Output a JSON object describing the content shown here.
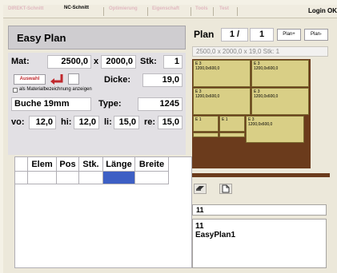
{
  "tabs": [
    {
      "label": "DIREKT-Schnitt",
      "active": false
    },
    {
      "label": "NC-Schnitt",
      "active": true
    },
    {
      "label": "Optimierung",
      "active": false
    },
    {
      "label": "Eigenschaft",
      "active": false
    },
    {
      "label": "Tools",
      "active": false
    },
    {
      "label": "Test",
      "active": false
    }
  ],
  "login_label": "Login OK",
  "title": "Easy Plan",
  "form": {
    "mat_label": "Mat:",
    "mat_width": "2500,0",
    "x_label": "x",
    "mat_height": "2000,0",
    "stk_label": "Stk:",
    "stk_value": "1",
    "auswahl_label": "Auswahl",
    "dicke_label": "Dicke:",
    "dicke_value": "19,0",
    "checkbox_label": "als Materialbezeichnung anzeigen",
    "material_name": "Buche 19mm",
    "type_label": "Type:",
    "type_value": "1245",
    "vo_label": "vo:",
    "vo_value": "12,0",
    "hi_label": "hi:",
    "hi_value": "12,0",
    "li_label": "li:",
    "li_value": "15,0",
    "re_label": "re:",
    "re_value": "15,0"
  },
  "grid_headers": [
    "Elem",
    "Pos",
    "Stk.",
    "Länge",
    "Breite"
  ],
  "plan": {
    "label": "Plan",
    "current": "1 /",
    "total": "1",
    "plus_label": "Plan+",
    "minus_label": "Plan-",
    "info": "2500,0 x 2000,0 x 19,0 Stk: 1"
  },
  "boards": [
    {
      "name": "E 3",
      "dims": "1200,0x600,0"
    },
    {
      "name": "E 3",
      "dims": "1200,0x600,0"
    },
    {
      "name": "E 3",
      "dims": "1200,0x600,0"
    },
    {
      "name": "E 3",
      "dims": "1200,0x600,0"
    },
    {
      "name": "E 1",
      "dims": ""
    },
    {
      "name": "E 1",
      "dims": ""
    },
    {
      "name": "E 3",
      "dims": "1200,0x600,0"
    }
  ],
  "name_field": "11",
  "text_lines": [
    "11",
    "EasyPlan1"
  ],
  "colors": {
    "board": "#d9cf86",
    "waste": "#6b3b1c",
    "selected_cell": "#3d5fc4"
  }
}
